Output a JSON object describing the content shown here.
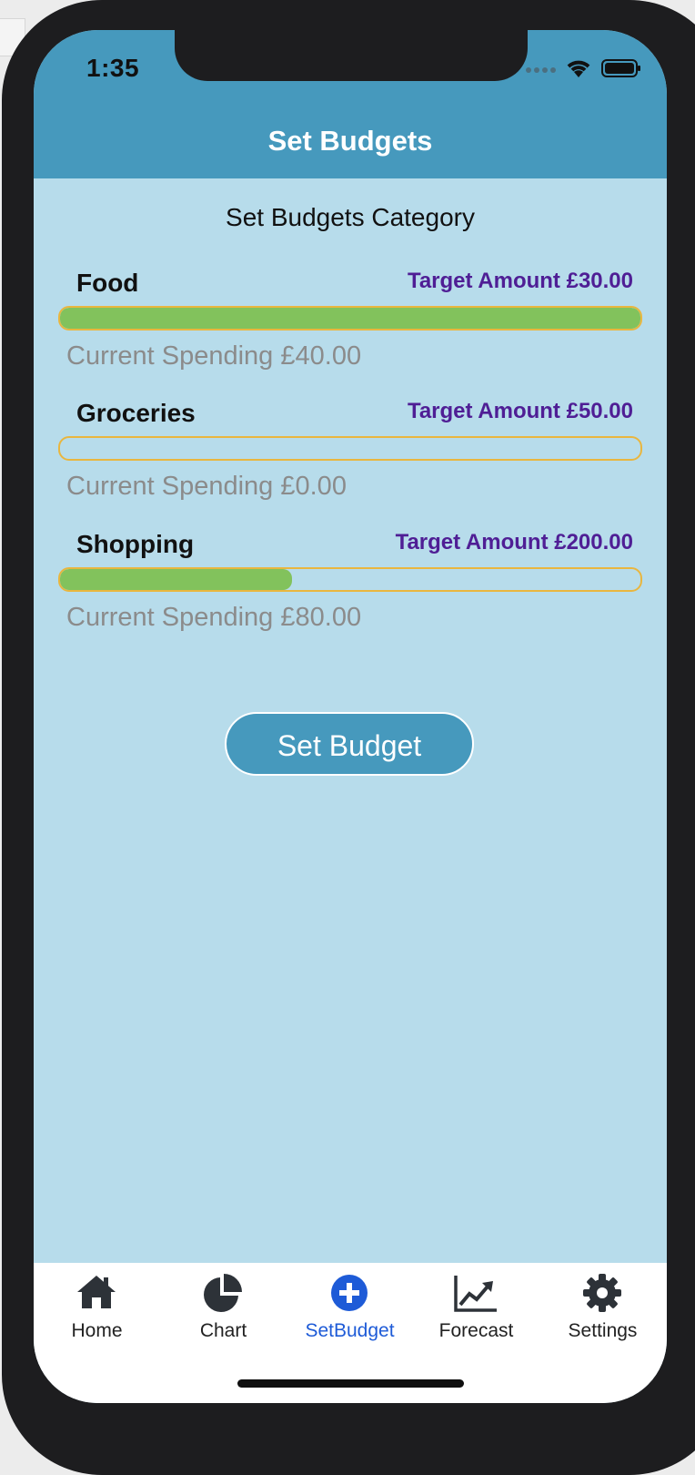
{
  "status_bar": {
    "time": "1:35"
  },
  "header": {
    "title": "Set Budgets"
  },
  "page": {
    "subtitle": "Set Budgets Category"
  },
  "budgets": [
    {
      "name": "Food",
      "target": "Target Amount £30.00",
      "current": "Current Spending £40.00",
      "progress": 1.0
    },
    {
      "name": "Groceries",
      "target": "Target Amount £50.00",
      "current": "Current Spending £0.00",
      "progress": 0.0
    },
    {
      "name": "Shopping",
      "target": "Target Amount £200.00",
      "current": "Current Spending £80.00",
      "progress": 0.4
    }
  ],
  "actions": {
    "set_budget_label": "Set Budget"
  },
  "tabs": [
    {
      "label": "Home",
      "icon": "home-icon"
    },
    {
      "label": "Chart",
      "icon": "pie-chart-icon"
    },
    {
      "label": "SetBudget",
      "icon": "plus-circle-icon",
      "active": true
    },
    {
      "label": "Forecast",
      "icon": "line-chart-icon"
    },
    {
      "label": "Settings",
      "icon": "gear-icon"
    }
  ],
  "colors": {
    "header": "#4699bd",
    "screen_bg": "#b7dceb",
    "progress_fill": "#82c25c",
    "progress_border": "#e9b63f",
    "target_text": "#4f1e95",
    "active_tab": "#1e5bd7"
  }
}
